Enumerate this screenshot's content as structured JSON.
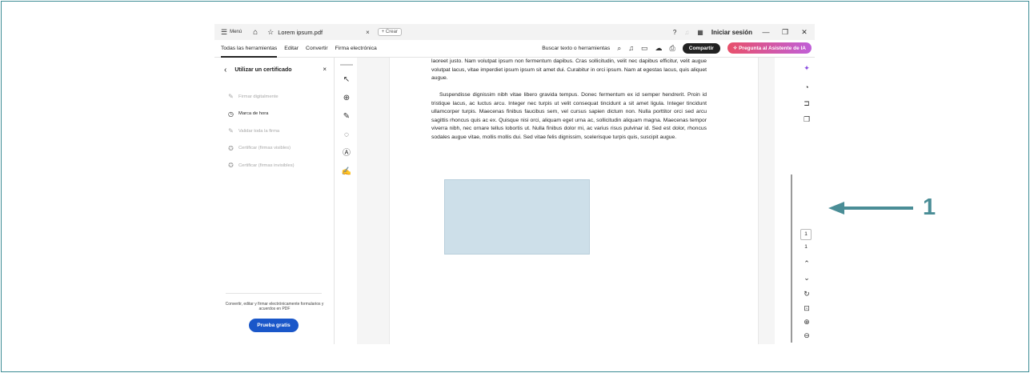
{
  "titlebar": {
    "menu_label": "Menú",
    "tab_title": "Lorem ipsum.pdf",
    "tab_close": "×",
    "create_label": "+ Crear",
    "signin_label": "Iniciar sesión",
    "minimize": "—",
    "restore": "❐",
    "close": "✕"
  },
  "menubar": {
    "items": [
      "Todas las herramientas",
      "Editar",
      "Convertir",
      "Firma electrónica"
    ],
    "search_label": "Buscar texto o herramientas",
    "share_label": "Compartir",
    "ai_label": "Pregunta al Asistente de IA"
  },
  "panel": {
    "title": "Utilizar un certificado",
    "close": "×",
    "items": [
      {
        "label": "Firmar digitalmente",
        "enabled": false
      },
      {
        "label": "Marca de hora",
        "enabled": true
      },
      {
        "label": "Validar toda la firma",
        "enabled": false
      },
      {
        "label": "Certificar (firmas visibles)",
        "enabled": false
      },
      {
        "label": "Certificar (firmas invisibles)",
        "enabled": false
      }
    ],
    "footer_text": "Convertir, editar y firmar electrónicamente formularios y acuerdos en PDF",
    "try_label": "Prueba gratis"
  },
  "document": {
    "para1": "laoreet justo. Nam volutpat ipsum non fermentum dapibus. Cras sollicitudin, velit nec dapibus efficitur, velit augue volutpat lacus, vitae imperdiet ipsum ipsum sit amet dui. Curabitur in orci ipsum. Nam at egestas lacus, quis aliquet augue.",
    "para2": "Suspendisse dignissim nibh vitae libero gravida tempus. Donec fermentum ex id semper hendrerit. Proin id tristique lacus, ac luctus arcu. Integer nec turpis ut velit consequat tincidunt a sit amet ligula. Integer tincidunt ullamcorper turpis. Maecenas finibus faucibus sem, vel cursus sapien dictum non. Nulla porttitor orci sed arcu sagittis rhoncus quis ac ex. Quisque nisi orci, aliquam eget urna ac, sollicitudin aliquam magna. Maecenas tempor viverra nibh, nec ornare tellus lobortis ut. Nulla finibus dolor mi, ac varius risus pulvinar id. Sed est dolor, rhoncus sodales augue vitae, mollis mollis dui. Sed vitae felis dignissim, scelerisque turpis quis, suscipit augue."
  },
  "pagination": {
    "current_page": "1",
    "total_pages": "1"
  },
  "annotation": {
    "callout_number": "1",
    "color": "#4a8d96"
  },
  "colors": {
    "accent_blue": "#1a57c9",
    "ai_gradient_start": "#e8506b",
    "ai_gradient_end": "#c05fd8",
    "frame_border": "#3d8d95",
    "image_placeholder": "#cddfe9"
  }
}
